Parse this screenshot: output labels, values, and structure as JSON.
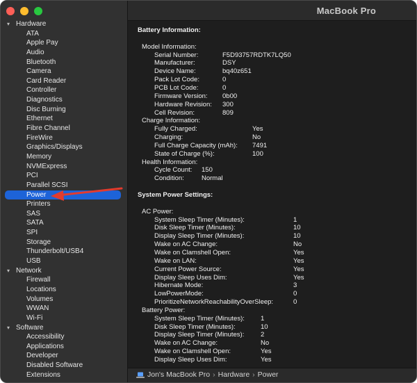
{
  "window": {
    "title": "MacBook Pro"
  },
  "sidebar": {
    "groups": [
      {
        "name": "Hardware",
        "items": [
          "ATA",
          "Apple Pay",
          "Audio",
          "Bluetooth",
          "Camera",
          "Card Reader",
          "Controller",
          "Diagnostics",
          "Disc Burning",
          "Ethernet",
          "Fibre Channel",
          "FireWire",
          "Graphics/Displays",
          "Memory",
          "NVMExpress",
          "PCI",
          "Parallel SCSI",
          "Power",
          "Printers",
          "SAS",
          "SATA",
          "SPI",
          "Storage",
          "Thunderbolt/USB4",
          "USB"
        ]
      },
      {
        "name": "Network",
        "items": [
          "Firewall",
          "Locations",
          "Volumes",
          "WWAN",
          "Wi-Fi"
        ]
      },
      {
        "name": "Software",
        "items": [
          "Accessibility",
          "Applications",
          "Developer",
          "Disabled Software",
          "Extensions"
        ]
      }
    ],
    "selected": "Power"
  },
  "content": {
    "lines": [
      {
        "label": "Battery Information:",
        "value": "",
        "level": 0
      },
      {
        "label": "",
        "value": "",
        "level": 0
      },
      {
        "label": "Model Information:",
        "value": "",
        "level": 1
      },
      {
        "label": "Serial Number:",
        "value": "F5D93757RDTK7LQ50",
        "level": 2
      },
      {
        "label": "Manufacturer:",
        "value": "DSY",
        "level": 2
      },
      {
        "label": "Device Name:",
        "value": "bq40z651",
        "level": 2
      },
      {
        "label": "Pack Lot Code:",
        "value": "0",
        "level": 2
      },
      {
        "label": "PCB Lot Code:",
        "value": "0",
        "level": 2
      },
      {
        "label": "Firmware Version:",
        "value": "0b00",
        "level": 2
      },
      {
        "label": "Hardware Revision:",
        "value": "300",
        "level": 2
      },
      {
        "label": "Cell Revision:",
        "value": "809",
        "level": 2
      },
      {
        "label": "Charge Information:",
        "value": "",
        "level": 1
      },
      {
        "label": "Fully Charged:",
        "value": "Yes",
        "level": 2
      },
      {
        "label": "Charging:",
        "value": "No",
        "level": 2
      },
      {
        "label": "Full Charge Capacity (mAh):",
        "value": "7491",
        "level": 2
      },
      {
        "label": "State of Charge (%):",
        "value": "100",
        "level": 2
      },
      {
        "label": "Health Information:",
        "value": "",
        "level": 1
      },
      {
        "label": "Cycle Count:",
        "value": "150",
        "level": 2
      },
      {
        "label": "Condition:",
        "value": "Normal",
        "level": 2
      },
      {
        "label": "",
        "value": "",
        "level": 0
      },
      {
        "label": "System Power Settings:",
        "value": "",
        "level": 0
      },
      {
        "label": "",
        "value": "",
        "level": 0
      },
      {
        "label": "AC Power:",
        "value": "",
        "level": 1
      },
      {
        "label": "System Sleep Timer (Minutes):",
        "value": "1",
        "level": 2
      },
      {
        "label": "Disk Sleep Timer (Minutes):",
        "value": "10",
        "level": 2
      },
      {
        "label": "Display Sleep Timer (Minutes):",
        "value": "10",
        "level": 2
      },
      {
        "label": "Wake on AC Change:",
        "value": "No",
        "level": 2
      },
      {
        "label": "Wake on Clamshell Open:",
        "value": "Yes",
        "level": 2
      },
      {
        "label": "Wake on LAN:",
        "value": "Yes",
        "level": 2
      },
      {
        "label": "Current Power Source:",
        "value": "Yes",
        "level": 2
      },
      {
        "label": "Display Sleep Uses Dim:",
        "value": "Yes",
        "level": 2
      },
      {
        "label": "Hibernate Mode:",
        "value": "3",
        "level": 2
      },
      {
        "label": "LowPowerMode:",
        "value": "0",
        "level": 2
      },
      {
        "label": "PrioritizeNetworkReachabilityOverSleep:",
        "value": "0",
        "level": 2
      },
      {
        "label": "Battery Power:",
        "value": "",
        "level": 1
      },
      {
        "label": "System Sleep Timer (Minutes):",
        "value": "1",
        "level": 2
      },
      {
        "label": "Disk Sleep Timer (Minutes):",
        "value": "10",
        "level": 2
      },
      {
        "label": "Display Sleep Timer (Minutes):",
        "value": "2",
        "level": 2
      },
      {
        "label": "Wake on AC Change:",
        "value": "No",
        "level": 2
      },
      {
        "label": "Wake on Clamshell Open:",
        "value": "Yes",
        "level": 2
      },
      {
        "label": "Display Sleep Uses Dim:",
        "value": "Yes",
        "level": 2
      }
    ]
  },
  "statusbar": {
    "crumbs": [
      "Jon's MacBook Pro",
      "Hardware",
      "Power"
    ],
    "separator": "›"
  },
  "colors": {
    "selection": "#1d63d8",
    "annotation_arrow": "#e23b2e"
  }
}
